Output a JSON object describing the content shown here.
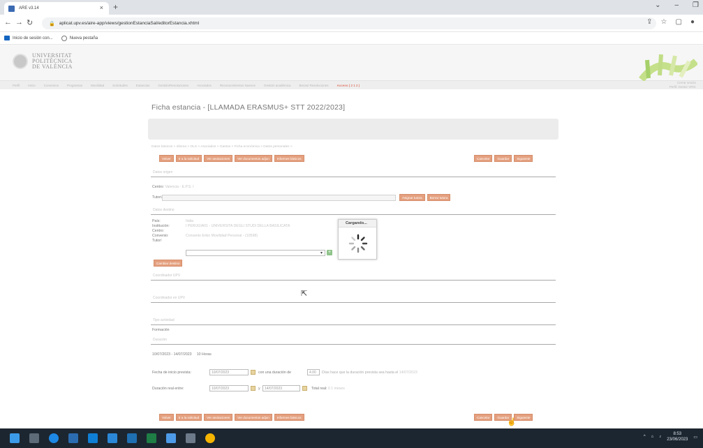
{
  "browser": {
    "tab_title": "ARE v3.14",
    "url": "aplicat.upv.es/aire-app/views/gestionEstanciaSal/editorEstancia.xhtml",
    "bookmarks": [
      {
        "label": "Inicio de sesión con..."
      },
      {
        "label": "Nueva pestaña"
      }
    ]
  },
  "site": {
    "university_name": [
      "UNIVERSITAT",
      "POLITÈCNICA",
      "DE VALÈNCIA"
    ],
    "menu": [
      "Perfil",
      "Inicio",
      "Convenios",
      "Programas",
      "Movilidad",
      "Solicitudes",
      "Estancias",
      "Gestión/Resoluciones",
      "Asociados",
      "Reconocimientos Nuevos",
      "Gestión académica",
      "Becas/ Resoluciones",
      "Acceso ( 2 1 2 )"
    ],
    "menu_active_index": 12,
    "user_line1": "Cerrar sesión",
    "user_line2": "Perfil: Gestor VRIC"
  },
  "page": {
    "title": "Ficha estancia - [LLAMADA ERASMUS+ STT 2022/2023]",
    "breadcrumb": "Datos básicos > Idioma > OLS > Asociados > Gastos > Ficha económica > Datos personales >",
    "top_buttons_left": [
      "Volver",
      "Ir a la solicitud",
      "Ver anotaciones",
      "Ver documentos adjun",
      "Informes básicos"
    ],
    "top_buttons_right": [
      "Cancelar",
      "Guardar",
      "Siguiente"
    ],
    "sections": {
      "datos_origen": "Datos origen",
      "datos_destino": "Datos destino",
      "coordinador_upv": "Coordinador UPV",
      "coordinador_en_upv": "Coordinador en UPV",
      "tipo_actividad": "Tipo actividad",
      "duracion": "Duración"
    },
    "origen": {
      "centro_label": "Centro:",
      "centro_value": "Valencia - E.P.S. I",
      "tutoria_label": "Tutoría:",
      "btn_asignar": "Asignar tutora",
      "btn_borrar": "Borrar tutora"
    },
    "destino": {
      "pais_label": "País:",
      "pais_value": "Italia",
      "institucion_label": "Institución:",
      "institucion_value": "I PERUGIA01 - UNIVERSITA DEGLI STUDI DELLA BASILICATA",
      "centro_label": "Centro:",
      "convenio_label": "Convenio:",
      "convenio_value": "Convenio Erkin Movilidad Personal - (10598)",
      "tutor_label": "Tutor/",
      "btn_cambiar": "Cambiar destino"
    },
    "loading_text": "Cargando...",
    "tipo_actividad_value": "Formación",
    "duracion_value": "10/07/2023 - 14/07/2023",
    "duracion_horas": "10 Horas",
    "fecha_inicio": {
      "label": "Fecha de inicio prevista:",
      "date": "10/07/2023",
      "duracion_text": "con una duración de",
      "dias": "4.00",
      "suffix": "Días hace que la duración prevista sea hasta el",
      "hasta": "14/07/2023"
    },
    "duracion_real": {
      "label": "Duración real entre:",
      "date1": "10/07/2023",
      "y": "y",
      "date2": "14/07/2023",
      "total_label": "Total real:",
      "total_value": "0 1 meses"
    },
    "bottom_buttons_left": [
      "Volver",
      "Ir a la solicitud",
      "Ver anotaciones",
      "Ver documentos adjun",
      "Informes básicos"
    ],
    "bottom_buttons_right": [
      "Cancelar",
      "Guardar",
      "Siguiente"
    ]
  },
  "taskbar": {
    "time": "8:53",
    "date": "23/06/2023"
  },
  "colors": {
    "button": "#e4a07f",
    "taskbar": "#1c2630",
    "menu_active": "#e07a6a"
  }
}
